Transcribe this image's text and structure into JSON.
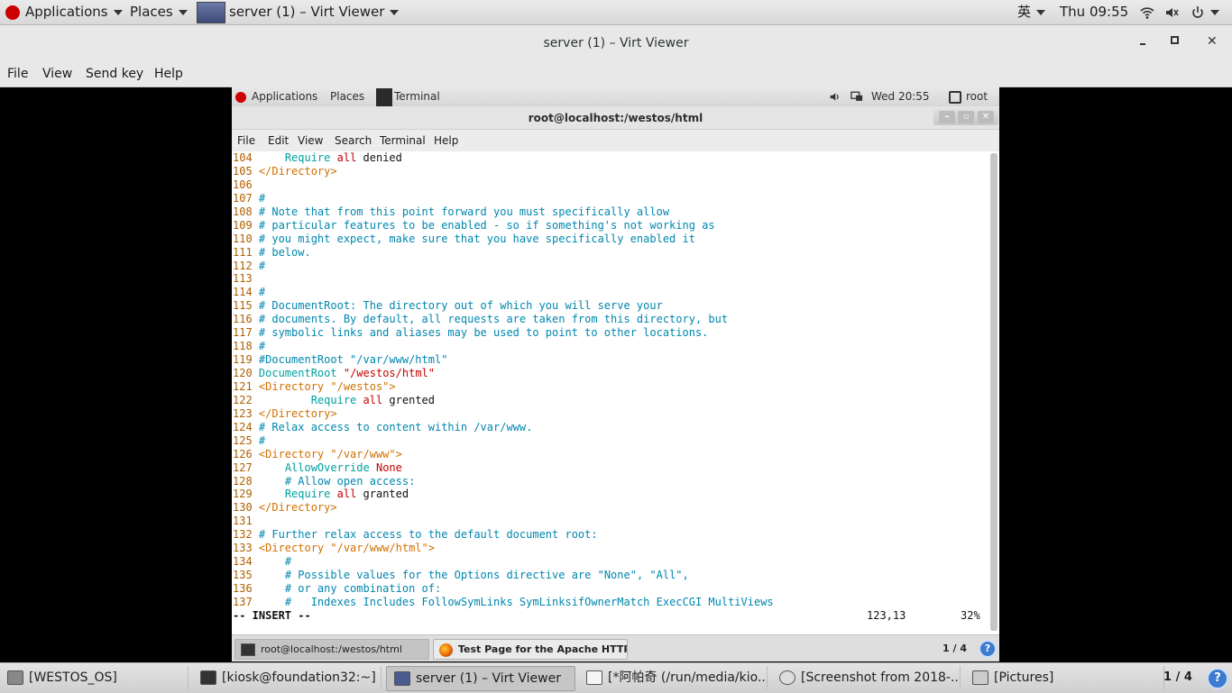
{
  "host_panel": {
    "applications": "Applications",
    "places": "Places",
    "window_title": "server (1) – Virt Viewer",
    "input_method": "英",
    "clock": "Thu 09:55"
  },
  "viewer": {
    "title": "server (1) – Virt Viewer",
    "menu": [
      "File",
      "View",
      "Send key",
      "Help"
    ]
  },
  "guest_panel": {
    "applications": "Applications",
    "places": "Places",
    "terminal_task": "Terminal",
    "clock": "Wed 20:55",
    "user": "root"
  },
  "terminal": {
    "title": "root@localhost:/westos/html",
    "menu": [
      "File",
      "Edit",
      "View",
      "Search",
      "Terminal",
      "Help"
    ]
  },
  "editor": {
    "lines": [
      {
        "n": "104",
        "parts": [
          [
            "",
            "    "
          ],
          [
            "kw",
            "Require"
          ],
          [
            "",
            " "
          ],
          [
            "st",
            "all"
          ],
          [
            "tx",
            " denied"
          ]
        ]
      },
      {
        "n": "105",
        "parts": [
          [
            "tg",
            "</Directory>"
          ]
        ]
      },
      {
        "n": "106",
        "parts": []
      },
      {
        "n": "107",
        "parts": [
          [
            "cm",
            "#"
          ]
        ]
      },
      {
        "n": "108",
        "parts": [
          [
            "cm",
            "# Note that from this point forward you must specifically allow"
          ]
        ]
      },
      {
        "n": "109",
        "parts": [
          [
            "cm",
            "# particular features to be enabled - so if something's not working as"
          ]
        ]
      },
      {
        "n": "110",
        "parts": [
          [
            "cm",
            "# you might expect, make sure that you have specifically enabled it"
          ]
        ]
      },
      {
        "n": "111",
        "parts": [
          [
            "cm",
            "# below."
          ]
        ]
      },
      {
        "n": "112",
        "parts": [
          [
            "cm",
            "#"
          ]
        ]
      },
      {
        "n": "113",
        "parts": []
      },
      {
        "n": "114",
        "parts": [
          [
            "cm",
            "#"
          ]
        ]
      },
      {
        "n": "115",
        "parts": [
          [
            "cm",
            "# DocumentRoot: The directory out of which you will serve your"
          ]
        ]
      },
      {
        "n": "116",
        "parts": [
          [
            "cm",
            "# documents. By default, all requests are taken from this directory, but"
          ]
        ]
      },
      {
        "n": "117",
        "parts": [
          [
            "cm",
            "# symbolic links and aliases may be used to point to other locations."
          ]
        ]
      },
      {
        "n": "118",
        "parts": [
          [
            "cm",
            "#"
          ]
        ]
      },
      {
        "n": "119",
        "parts": [
          [
            "cm",
            "#DocumentRoot \"/var/www/html\""
          ]
        ]
      },
      {
        "n": "120",
        "parts": [
          [
            "kw",
            "DocumentRoot"
          ],
          [
            "",
            " "
          ],
          [
            "st",
            "\"/westos/html\""
          ]
        ]
      },
      {
        "n": "121",
        "parts": [
          [
            "tg",
            "<Directory \"/westos\">"
          ]
        ]
      },
      {
        "n": "122",
        "parts": [
          [
            "",
            "        "
          ],
          [
            "kw",
            "Require"
          ],
          [
            "",
            " "
          ],
          [
            "st",
            "all"
          ],
          [
            "tx",
            " grented"
          ]
        ]
      },
      {
        "n": "123",
        "parts": [
          [
            "tg",
            "</Directory>"
          ]
        ]
      },
      {
        "n": "124",
        "parts": [
          [
            "cm",
            "# Relax access to content within /var/www."
          ]
        ]
      },
      {
        "n": "125",
        "parts": [
          [
            "cm",
            "#"
          ]
        ]
      },
      {
        "n": "126",
        "parts": [
          [
            "tg",
            "<Directory \"/var/www\">"
          ]
        ]
      },
      {
        "n": "127",
        "parts": [
          [
            "",
            "    "
          ],
          [
            "kw",
            "AllowOverride"
          ],
          [
            "",
            " "
          ],
          [
            "st",
            "None"
          ]
        ]
      },
      {
        "n": "128",
        "parts": [
          [
            "",
            "    "
          ],
          [
            "cm",
            "# Allow open access:"
          ]
        ]
      },
      {
        "n": "129",
        "parts": [
          [
            "",
            "    "
          ],
          [
            "kw",
            "Require"
          ],
          [
            "",
            " "
          ],
          [
            "st",
            "all"
          ],
          [
            "tx",
            " granted"
          ]
        ]
      },
      {
        "n": "130",
        "parts": [
          [
            "tg",
            "</Directory>"
          ]
        ]
      },
      {
        "n": "131",
        "parts": []
      },
      {
        "n": "132",
        "parts": [
          [
            "cm",
            "# Further relax access to the default document root:"
          ]
        ]
      },
      {
        "n": "133",
        "parts": [
          [
            "tg",
            "<Directory \"/var/www/html\">"
          ]
        ]
      },
      {
        "n": "134",
        "parts": [
          [
            "",
            "    "
          ],
          [
            "cm",
            "#"
          ]
        ]
      },
      {
        "n": "135",
        "parts": [
          [
            "",
            "    "
          ],
          [
            "cm",
            "# Possible values for the Options directive are \"None\", \"All\","
          ]
        ]
      },
      {
        "n": "136",
        "parts": [
          [
            "",
            "    "
          ],
          [
            "cm",
            "# or any combination of:"
          ]
        ]
      },
      {
        "n": "137",
        "parts": [
          [
            "",
            "    "
          ],
          [
            "cm",
            "#   Indexes Includes FollowSymLinks SymLinksifOwnerMatch ExecCGI MultiViews"
          ]
        ]
      }
    ],
    "mode": "-- INSERT --",
    "position": "123,13",
    "percent": "32%"
  },
  "guest_taskbar": {
    "task1": "root@localhost:/westos/html",
    "task2": "Test Page for the Apache HTTP ...",
    "pager": "1 / 4",
    "help_glyph": "?"
  },
  "host_taskbar": {
    "tasks": [
      "[WESTOS_OS]",
      "[kiosk@foundation32:~]",
      "server (1) – Virt Viewer",
      "[*阿帕奇 (/run/media/kio...",
      "[Screenshot from 2018-...",
      "[Pictures]"
    ],
    "pager": "1 / 4"
  },
  "colors": {
    "line_number": "#af5f00",
    "comment": "#0087af",
    "keyword": "#00a0a0",
    "string": "#c40000",
    "tag": "#d07000"
  }
}
